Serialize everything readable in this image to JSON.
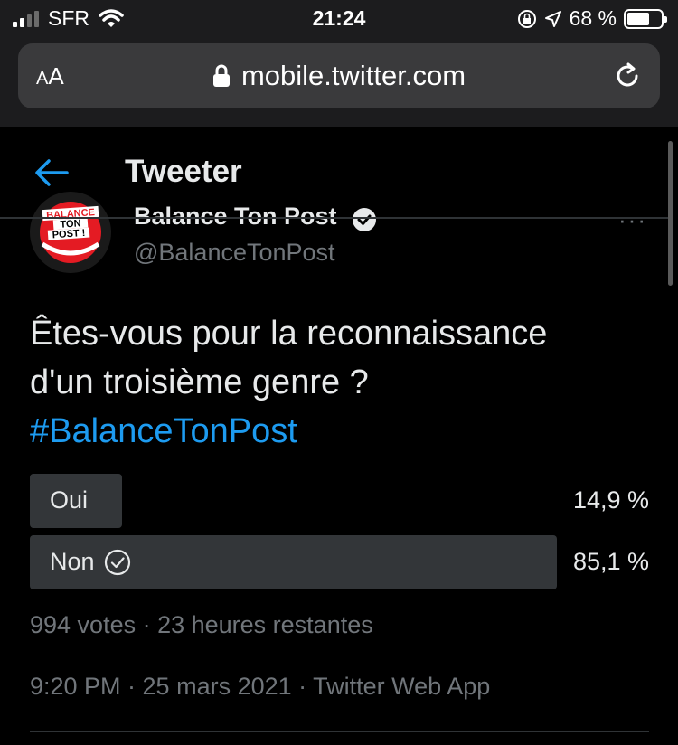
{
  "status_bar": {
    "carrier": "SFR",
    "time": "21:24",
    "battery": "68 %",
    "battery_level": 0.68
  },
  "browser": {
    "aa_label_small": "A",
    "aa_label_large": "A",
    "url": "mobile.twitter.com"
  },
  "header": {
    "title": "Tweeter"
  },
  "tweet": {
    "avatar_text": [
      "BALANCE",
      "TON",
      "POST !"
    ],
    "display_name": "Balance Ton Post",
    "handle": "@BalanceTonPost",
    "text_line1": "Êtes-vous pour la reconnaissance",
    "text_line2": "d'un troisième genre ?",
    "hashtag": "#BalanceTonPost",
    "poll": {
      "options": [
        {
          "label": "Oui",
          "percent_label": "14,9 %",
          "percent": 14.9,
          "selected": false
        },
        {
          "label": "Non",
          "percent_label": "85,1 %",
          "percent": 85.1,
          "selected": true
        }
      ],
      "meta": "994 votes · 23 heures restantes"
    },
    "timestamp": "9:20 PM · 25 mars 2021 · Twitter Web App"
  },
  "colors": {
    "accent": "#1d9bf0",
    "poll_bar": "#333639",
    "muted": "#71767b"
  }
}
